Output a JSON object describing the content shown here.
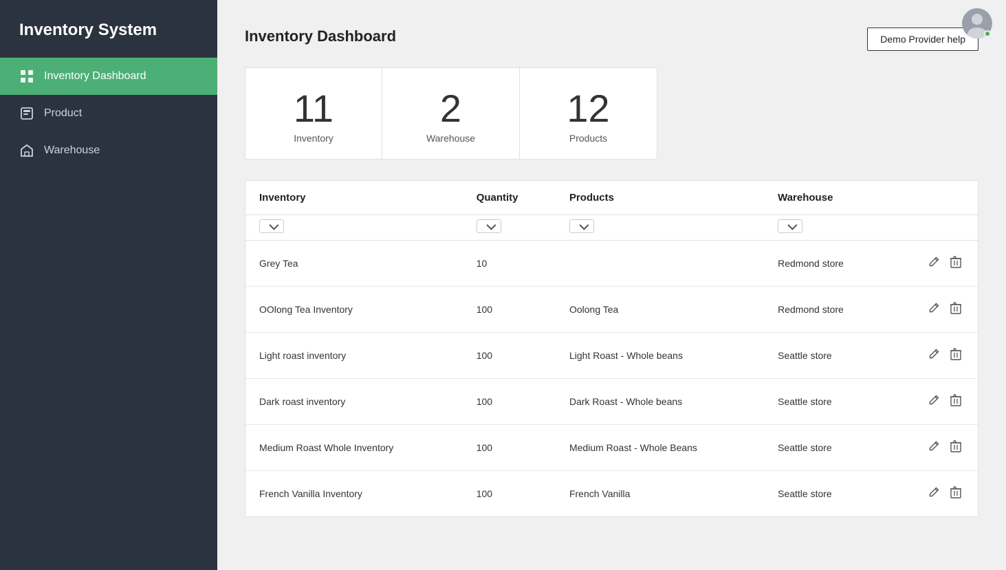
{
  "sidebar": {
    "title": "Inventory System",
    "nav": [
      {
        "id": "dashboard",
        "label": "Inventory Dashboard",
        "active": true,
        "icon": "dashboard-icon"
      },
      {
        "id": "product",
        "label": "Product",
        "active": false,
        "icon": "product-icon"
      },
      {
        "id": "warehouse",
        "label": "Warehouse",
        "active": false,
        "icon": "warehouse-icon"
      }
    ]
  },
  "topbar": {
    "demo_btn": "Demo Provider help"
  },
  "page": {
    "title": "Inventory Dashboard"
  },
  "stats": [
    {
      "id": "inventory-stat",
      "number": "11",
      "label": "Inventory"
    },
    {
      "id": "warehouse-stat",
      "number": "2",
      "label": "Warehouse"
    },
    {
      "id": "products-stat",
      "number": "12",
      "label": "Products"
    }
  ],
  "table": {
    "columns": [
      "Inventory",
      "Quantity",
      "Products",
      "Warehouse"
    ],
    "rows": [
      {
        "inventory": "Grey Tea",
        "quantity": "10",
        "products": "",
        "warehouse": "Redmond store"
      },
      {
        "inventory": "OOlong Tea Inventory",
        "quantity": "100",
        "products": "Oolong Tea",
        "warehouse": "Redmond store"
      },
      {
        "inventory": "Light roast inventory",
        "quantity": "100",
        "products": "Light Roast - Whole beans",
        "warehouse": "Seattle store"
      },
      {
        "inventory": "Dark roast inventory",
        "quantity": "100",
        "products": "Dark Roast - Whole beans",
        "warehouse": "Seattle store"
      },
      {
        "inventory": "Medium Roast Whole Inventory",
        "quantity": "100",
        "products": "Medium Roast - Whole Beans",
        "warehouse": "Seattle store"
      },
      {
        "inventory": "French Vanilla Inventory",
        "quantity": "100",
        "products": "French Vanilla",
        "warehouse": "Seattle store"
      }
    ]
  }
}
